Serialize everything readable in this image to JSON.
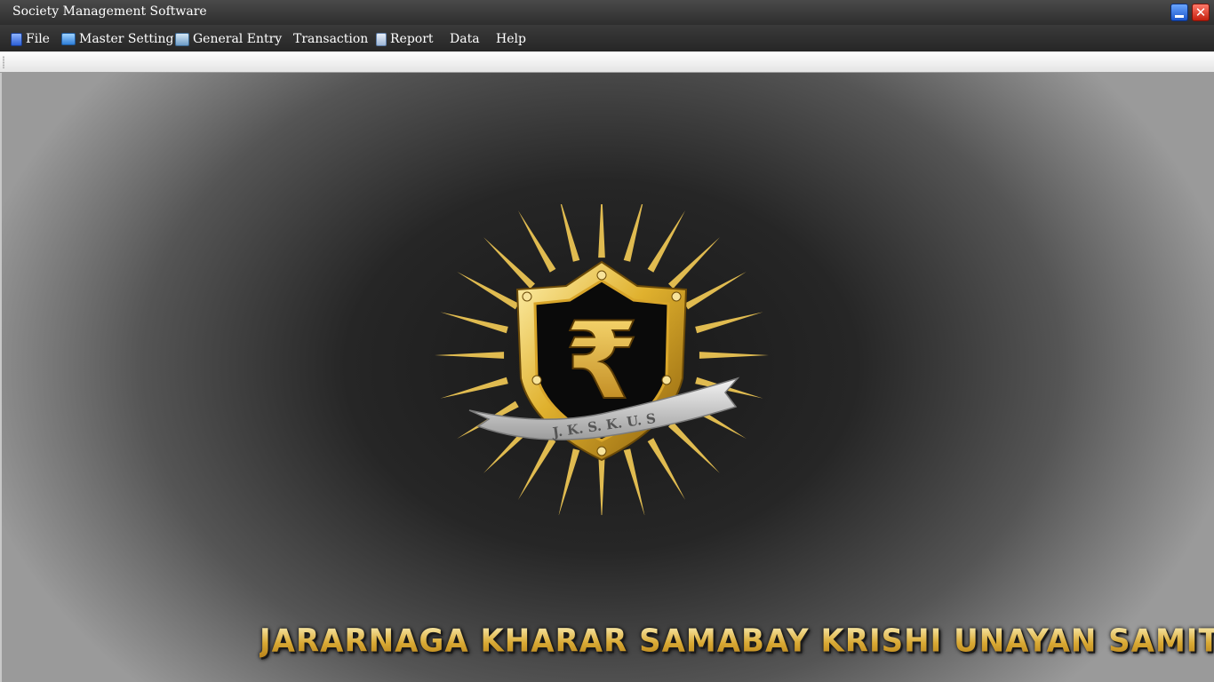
{
  "window": {
    "title": "Society Management Software",
    "controls": {
      "minimize_icon": "minimize-icon",
      "close_symbol": "✕"
    }
  },
  "menu": {
    "items": [
      {
        "label": "File",
        "icon": "document-icon"
      },
      {
        "label": "Master Setting",
        "icon": "users-icon"
      },
      {
        "label": "General Entry",
        "icon": "entry-icon"
      },
      {
        "label": "Transaction",
        "icon": ""
      },
      {
        "label": "Report",
        "icon": "report-icon"
      },
      {
        "label": "Data",
        "icon": ""
      },
      {
        "label": "Help",
        "icon": ""
      }
    ]
  },
  "logo": {
    "symbol": "₹",
    "ribbon_text": "J. K. S. K. U. S",
    "colors": {
      "gold": "#e0b12e",
      "ray": "#f5cc55",
      "ribbon": "#d8d8d8"
    }
  },
  "organization": {
    "name": "JARARNAGA KHARAR SAMABAY KRISHI UNAYAN SAMITI LTD"
  }
}
